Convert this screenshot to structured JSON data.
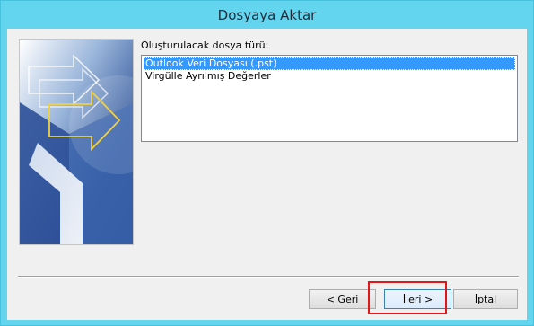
{
  "window": {
    "title": "Dosyaya Aktar"
  },
  "list": {
    "label": "Oluşturulacak dosya türü:",
    "items": [
      {
        "label": "Outlook Veri Dosyası (.pst)",
        "selected": true
      },
      {
        "label": "Virgülle Ayrılmış Değerler",
        "selected": false
      }
    ]
  },
  "buttons": {
    "back": "< Geri",
    "next": "İleri >",
    "cancel": "İptal"
  },
  "colors": {
    "titlebar": "#64d5ef",
    "selection": "#3399ff",
    "highlight": "#e0161b"
  }
}
